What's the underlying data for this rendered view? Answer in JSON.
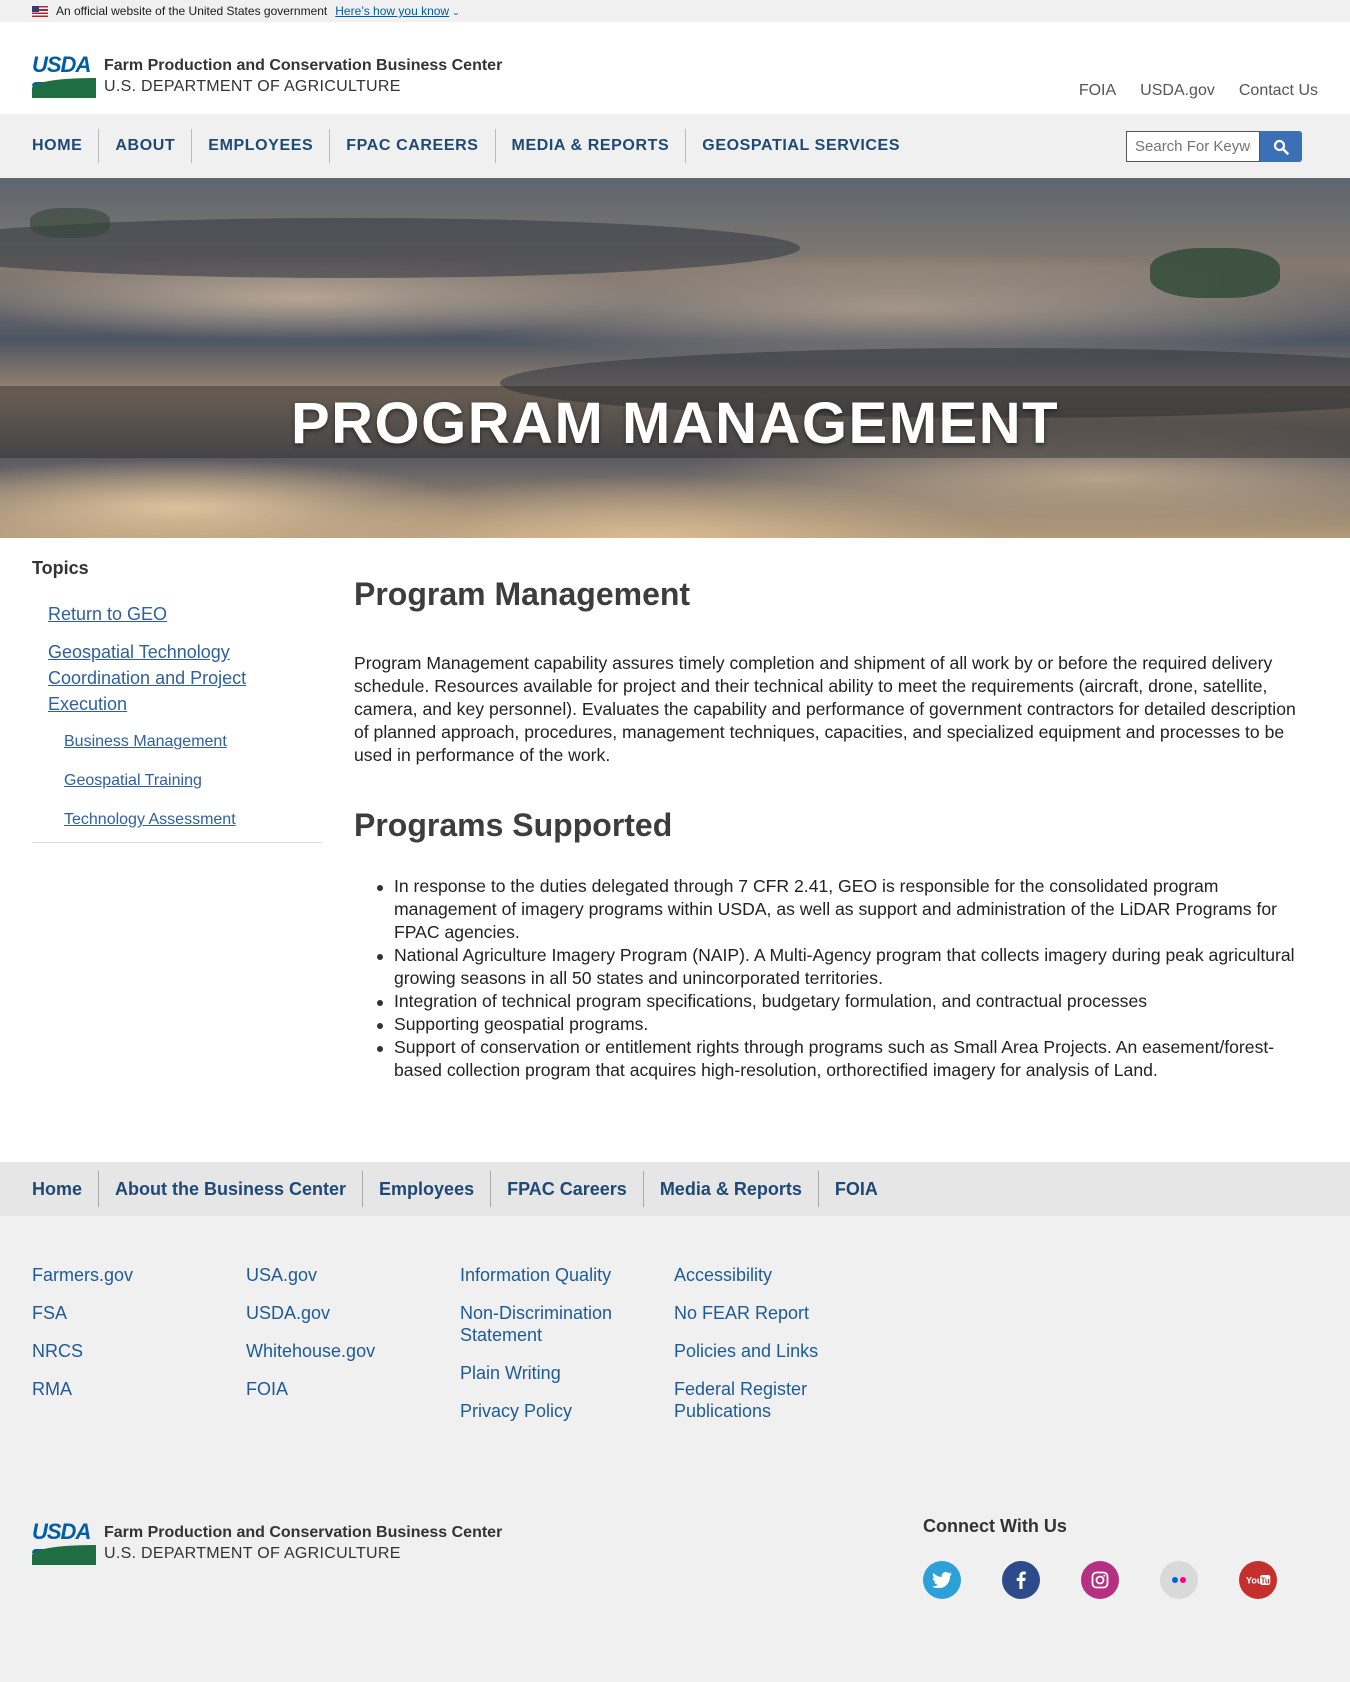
{
  "gov_banner": {
    "text": "An official website of the United States government",
    "link": "Here’s how you know"
  },
  "header": {
    "logo_text": "USDA",
    "org_name": "Farm Production and Conservation Business Center",
    "dept_name": "U.S. DEPARTMENT OF AGRICULTURE",
    "utility_links": [
      "FOIA",
      "USDA.gov",
      "Contact Us"
    ]
  },
  "nav": {
    "items": [
      "HOME",
      "ABOUT",
      "EMPLOYEES",
      "FPAC CAREERS",
      "MEDIA & REPORTS",
      "GEOSPATIAL SERVICES"
    ],
    "search_placeholder": "Search For Keywords"
  },
  "hero": {
    "title": "PROGRAM MANAGEMENT"
  },
  "sidebar": {
    "title": "Topics",
    "links": [
      "Return to GEO",
      "Geospatial Technology Coordination and Project Execution"
    ],
    "sublinks": [
      "Business Management",
      "Geospatial Training",
      "Technology Assessment"
    ]
  },
  "main": {
    "heading": "Program Management",
    "paragraph": "Program Management capability assures timely completion and shipment of all work by or before the required delivery schedule. Resources available for project and their technical ability to meet the requirements (aircraft, drone, satellite, camera, and key personnel). Evaluates the capability and performance of government contractors for detailed description of planned approach, procedures, management techniques, capacities, and specialized equipment and processes to be used in performance of the work.",
    "subheading": "Programs Supported",
    "bullets": [
      "In response to the duties delegated through 7 CFR 2.41, GEO is responsible for the consolidated program management of imagery programs within USDA, as well as support and administration of the LiDAR Programs for FPAC agencies.",
      "National Agriculture Imagery Program (NAIP). A Multi-Agency program that collects imagery during peak agricultural growing seasons in all 50 states and unincorporated territories.",
      "Integration of technical program specifications, budgetary formulation, and contractual processes",
      "Supporting geospatial programs.",
      "Support of conservation or entitlement rights through programs such as Small Area Projects. An easement/forest-based collection program that acquires high-resolution, orthorectified imagery for analysis of Land."
    ]
  },
  "footer_nav": [
    "Home",
    "About the Business Center",
    "Employees",
    "FPAC Careers",
    "Media & Reports",
    "FOIA"
  ],
  "footer_links": {
    "col1": [
      "Farmers.gov",
      "FSA",
      "NRCS",
      "RMA"
    ],
    "col2": [
      "USA.gov",
      "USDA.gov",
      "Whitehouse.gov",
      "FOIA"
    ],
    "col3": [
      "Information Quality",
      "Non-Discrimination Statement",
      "Plain Writing",
      "Privacy Policy"
    ],
    "col4": [
      "Accessibility",
      "No FEAR Report",
      "Policies and Links",
      "Federal Register Publications"
    ]
  },
  "connect": {
    "title": "Connect With Us",
    "icons": [
      "twitter-icon",
      "facebook-icon",
      "instagram-icon",
      "flickr-icon",
      "youtube-icon"
    ]
  },
  "colors": {
    "nav_text": "#1e4976",
    "link": "#2e5fa3",
    "search_button": "#3b6fb6",
    "twitter": "#2ea0d8",
    "facebook": "#2d4a8a",
    "instagram": "#b52f82",
    "flickr": "#d9d9d9",
    "youtube": "#c4302b"
  }
}
